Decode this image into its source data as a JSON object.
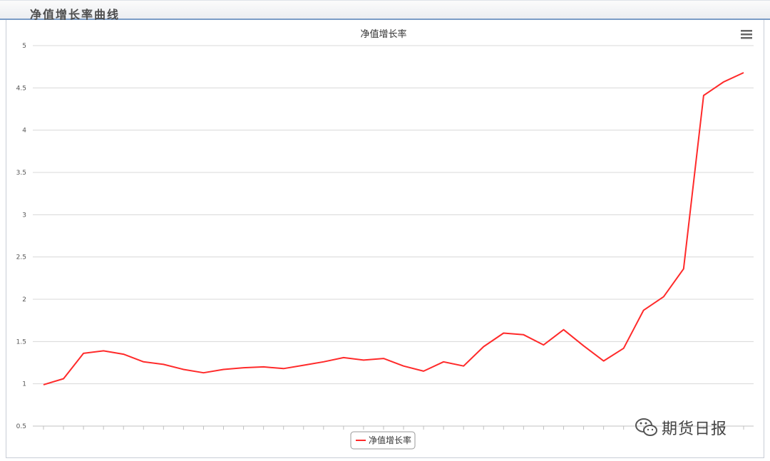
{
  "header": {
    "title": "净值增长率曲线"
  },
  "chart_data": {
    "type": "line",
    "title": "净值增长率",
    "xlabel": "",
    "ylabel": "",
    "ylim": [
      0.5,
      5
    ],
    "yticks": [
      "0.5",
      "1",
      "1.5",
      "2",
      "2.5",
      "3",
      "3.5",
      "4",
      "4.5",
      "5"
    ],
    "grid": true,
    "legend_position": "bottom-center",
    "series": [
      {
        "name": "净值增长率",
        "color": "#ff2a2a",
        "values": [
          0.99,
          1.06,
          1.36,
          1.39,
          1.35,
          1.26,
          1.23,
          1.17,
          1.13,
          1.17,
          1.19,
          1.2,
          1.18,
          1.22,
          1.26,
          1.31,
          1.28,
          1.3,
          1.21,
          1.15,
          1.26,
          1.21,
          1.44,
          1.6,
          1.58,
          1.46,
          1.64,
          1.45,
          1.27,
          1.42,
          1.87,
          2.03,
          2.36,
          4.41,
          4.57,
          4.68
        ]
      }
    ]
  },
  "toolbar": {
    "menu_icon": "hamburger-menu-icon"
  },
  "watermark": {
    "text": "期货日报",
    "icon": "wechat-icon"
  }
}
